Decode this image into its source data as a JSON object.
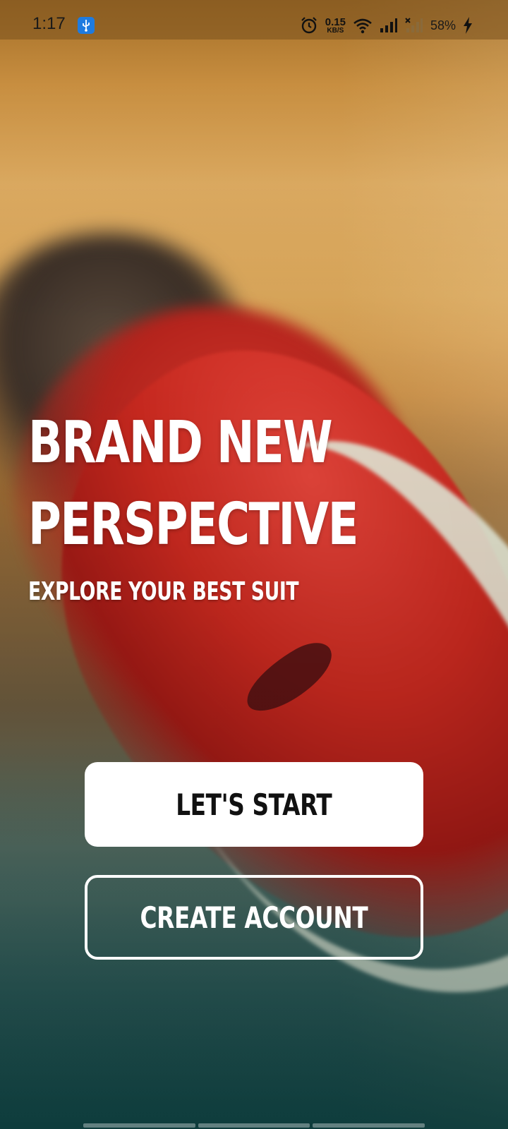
{
  "status_bar": {
    "time": "1:17",
    "net_speed_value": "0.15",
    "net_speed_unit": "KB/S",
    "battery": "58%",
    "icons": [
      "usb-icon",
      "alarm-icon",
      "wifi-icon",
      "signal-icon",
      "signal-no-service-icon",
      "charging-bolt-icon"
    ]
  },
  "hero": {
    "title_line1": "BRAND NEW",
    "title_line2": "PERSPECTIVE",
    "subtitle": "EXPLORE YOUR BEST SUIT"
  },
  "actions": {
    "start_label": "LET'S START",
    "create_label": "CREATE ACCOUNT"
  },
  "colors": {
    "primary_button_bg": "#ffffff",
    "primary_button_text": "#111111",
    "outline_button_border": "#ffffff",
    "text_on_image": "#ffffff",
    "usb_badge": "#1e7be0"
  }
}
